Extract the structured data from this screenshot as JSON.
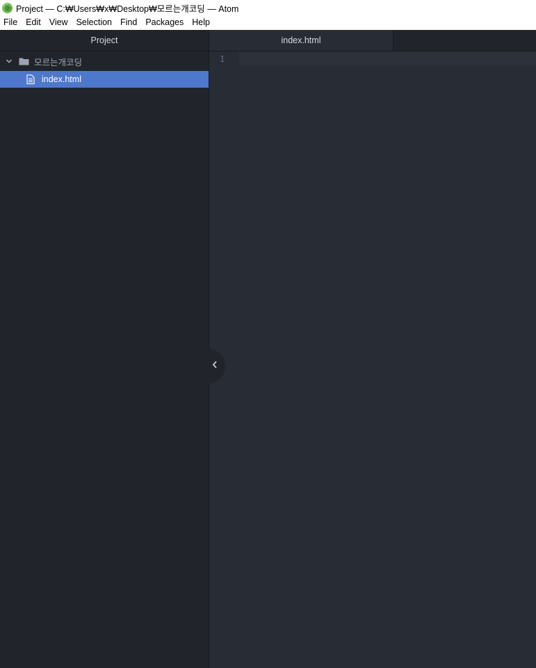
{
  "window": {
    "title": "Project — C:₩Users₩x₩Desktop₩모르는개코딩 — Atom"
  },
  "menu": {
    "items": [
      {
        "label": "File"
      },
      {
        "label": "Edit"
      },
      {
        "label": "View"
      },
      {
        "label": "Selection"
      },
      {
        "label": "Find"
      },
      {
        "label": "Packages"
      },
      {
        "label": "Help"
      }
    ]
  },
  "sidebar": {
    "header": "Project",
    "folder": {
      "name": "모르는개코딩",
      "icon": "folder-icon",
      "expanded": true
    },
    "files": [
      {
        "name": "index.html",
        "icon": "file-text-icon",
        "selected": true
      }
    ]
  },
  "editor": {
    "tabs": [
      {
        "label": "index.html",
        "active": true
      }
    ],
    "lines": [
      {
        "number": "1",
        "text": ""
      }
    ]
  },
  "colors": {
    "sidebar_bg": "#21252b",
    "editor_bg": "#282c34",
    "selection": "#4d78cc",
    "text": "#d7dae0",
    "muted_text": "#9da5b4",
    "line_number": "#636d83"
  }
}
